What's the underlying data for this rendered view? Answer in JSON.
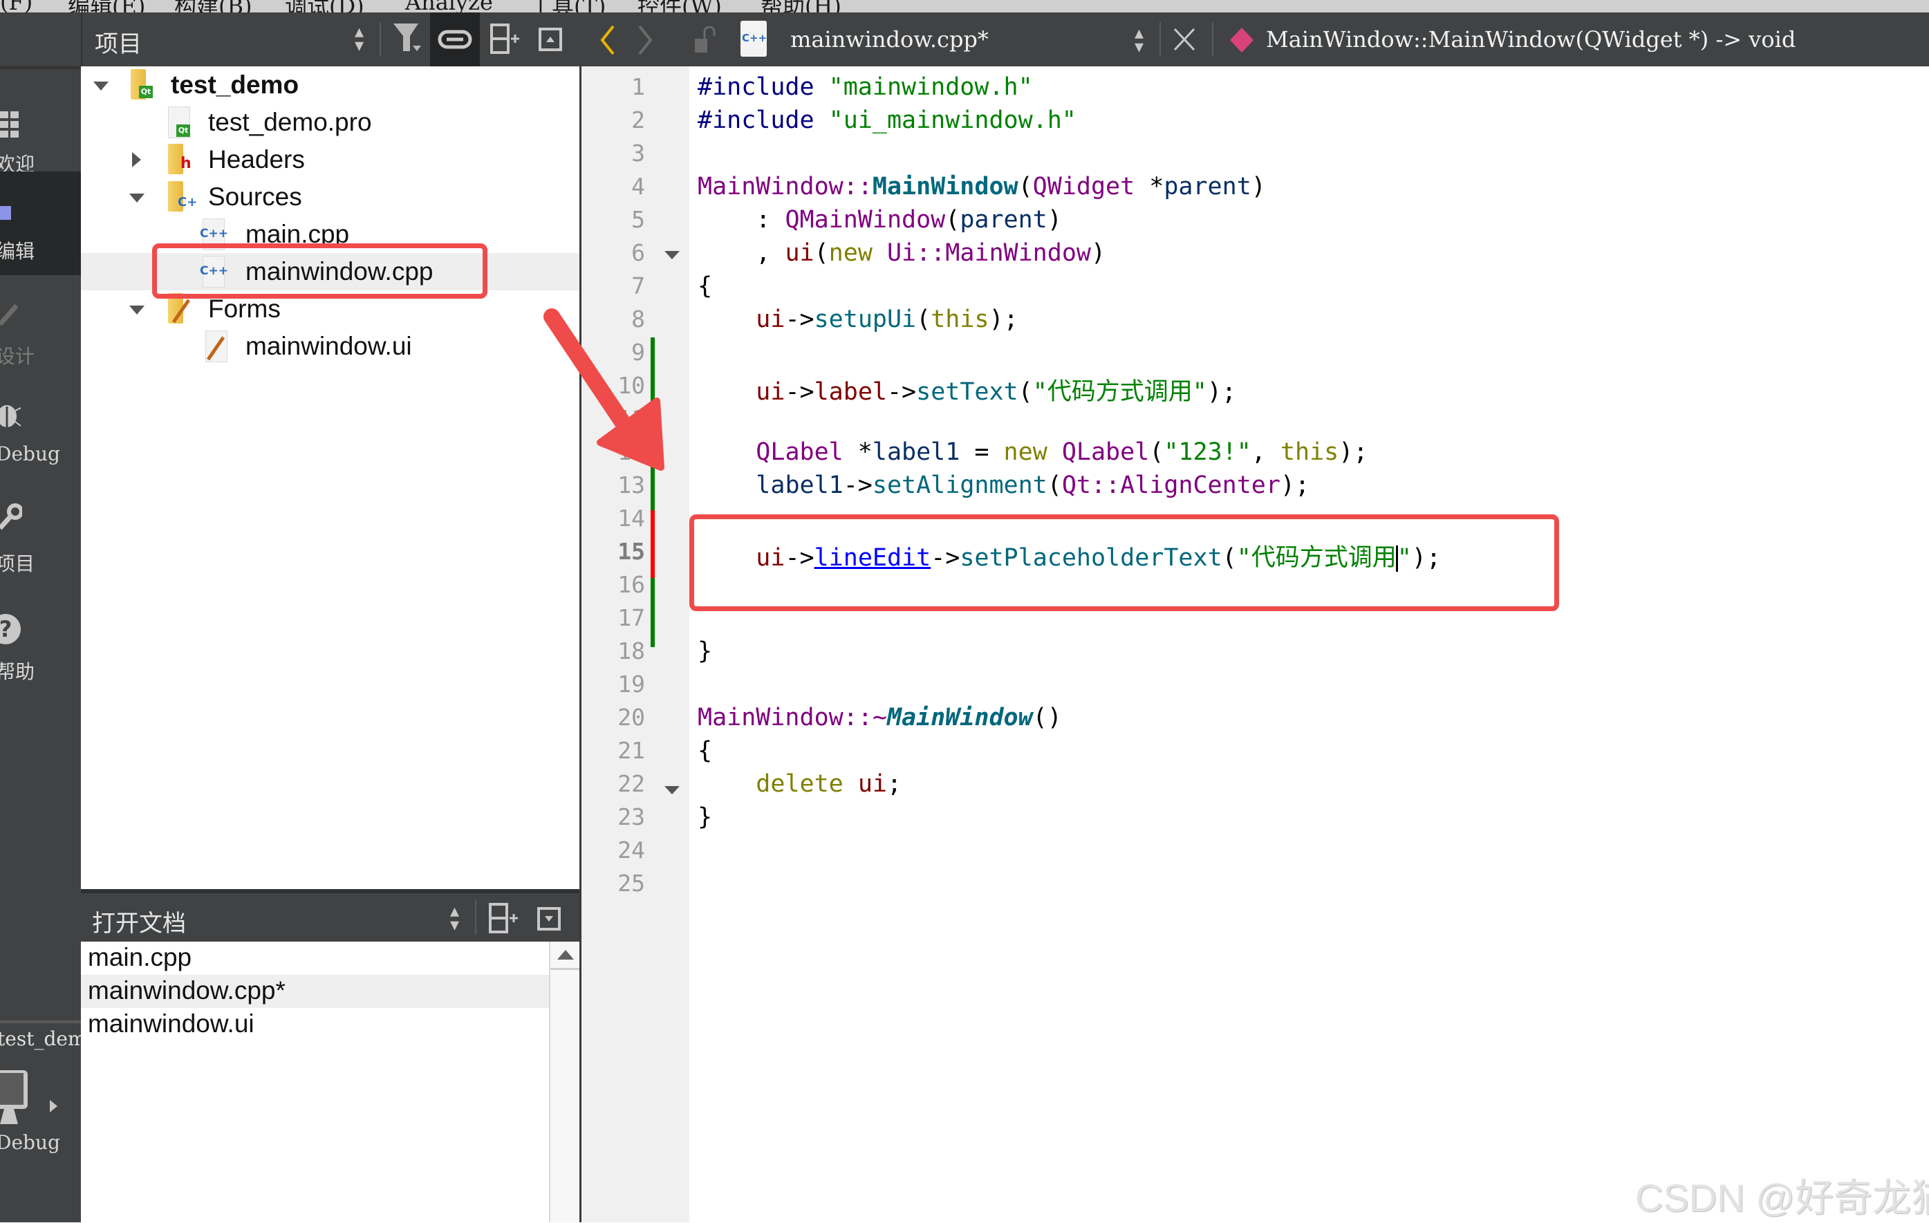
{
  "menu": {
    "items": [
      "(F)",
      "编辑(E)",
      "构建(B)",
      "调试(D)",
      "Analyze",
      "工具(T)",
      "控件(W)",
      "帮助(H)"
    ]
  },
  "modes": [
    {
      "label": "欢迎",
      "icon": "grid-icon",
      "active": false
    },
    {
      "label": "编辑",
      "icon": "edit-doc-icon",
      "active": true
    },
    {
      "label": "设计",
      "icon": "pencil-icon",
      "active": false,
      "disabled": true
    },
    {
      "label": "Debug",
      "icon": "bug-icon",
      "active": false
    },
    {
      "label": "项目",
      "icon": "wrench-icon",
      "active": false
    },
    {
      "label": "帮助",
      "icon": "help-icon",
      "active": false
    }
  ],
  "kit": {
    "project": "test_demo",
    "build": "Debug"
  },
  "project_pane": {
    "title": "项目",
    "tree": [
      {
        "label": "test_demo",
        "level": 0,
        "kind": "project",
        "expanded": true
      },
      {
        "label": "test_demo.pro",
        "level": 1,
        "kind": "pro-file"
      },
      {
        "label": "Headers",
        "level": 1,
        "kind": "folder-h",
        "expanded": false
      },
      {
        "label": "Sources",
        "level": 1,
        "kind": "folder-cpp",
        "expanded": true
      },
      {
        "label": "main.cpp",
        "level": 2,
        "kind": "cpp-file"
      },
      {
        "label": "mainwindow.cpp",
        "level": 2,
        "kind": "cpp-file",
        "selected": true
      },
      {
        "label": "Forms",
        "level": 1,
        "kind": "folder-ui",
        "expanded": true
      },
      {
        "label": "mainwindow.ui",
        "level": 2,
        "kind": "ui-file"
      }
    ]
  },
  "open_docs": {
    "title": "打开文档",
    "items": [
      {
        "label": "main.cpp"
      },
      {
        "label": "mainwindow.cpp*",
        "selected": true
      },
      {
        "label": "mainwindow.ui"
      }
    ]
  },
  "editor": {
    "file_name": "mainwindow.cpp*",
    "symbol": "MainWindow::MainWindow(QWidget *) -> void",
    "current_line": 15,
    "line_numbers": [
      "1",
      "2",
      "3",
      "4",
      "5",
      "6",
      "7",
      "8",
      "9",
      "10",
      "11",
      "12",
      "13",
      "14",
      "15",
      "16",
      "17",
      "18",
      "19",
      "20",
      "21",
      "22",
      "23",
      "24",
      "25"
    ],
    "lines": {
      "l1a": "#include ",
      "l1b": "\"mainwindow.h\"",
      "l2a": "#include ",
      "l2b": "\"ui_mainwindow.h\"",
      "l4a": "MainWindow::",
      "l4b": "MainWindow",
      "l4c": "(",
      "l4d": "QWidget",
      "l4e": " *",
      "l4f": "parent",
      "l4g": ")",
      "l5a": "    : ",
      "l5b": "QMainWindow",
      "l5c": "(",
      "l5d": "parent",
      "l5e": ")",
      "l6a": "    , ",
      "l6b": "ui",
      "l6c": "(",
      "l6d": "new",
      "l6e": " ",
      "l6f": "Ui::MainWindow",
      "l6g": ")",
      "l7a": "{",
      "l8a": "    ",
      "l8b": "ui",
      "l8c": "->",
      "l8d": "setupUi",
      "l8e": "(",
      "l8f": "this",
      "l8g": ");",
      "l10a": "    ",
      "l10b": "ui",
      "l10c": "->",
      "l10d": "label",
      "l10e": "->",
      "l10f": "setText",
      "l10g": "(",
      "l10h": "\"代码方式调用\"",
      "l10i": ");",
      "l12a": "    ",
      "l12b": "QLabel",
      "l12c": " *",
      "l12d": "label1",
      "l12e": " = ",
      "l12f": "new",
      "l12g": " ",
      "l12h": "QLabel",
      "l12i": "(",
      "l12j": "\"123!\"",
      "l12k": ", ",
      "l12l": "this",
      "l12m": ");",
      "l13a": "    ",
      "l13b": "label1",
      "l13c": "->",
      "l13d": "setAlignment",
      "l13e": "(",
      "l13f": "Qt::AlignCenter",
      "l13g": ");",
      "l15a": "    ",
      "l15b": "ui",
      "l15c": "->",
      "l15d": "lineEdit",
      "l15e": "->",
      "l15f": "setPlaceholderText",
      "l15g": "(",
      "l15h": "\"代码方式调用",
      "l15i": "\"",
      "l15j": ");",
      "l18a": "}",
      "l20a": "MainWindow::~",
      "l20b": "MainWindow",
      "l20c": "()",
      "l21a": "{",
      "l22a": "    ",
      "l22b": "delete",
      "l22c": " ",
      "l22d": "ui",
      "l22e": ";",
      "l23a": "}"
    }
  },
  "watermark": "CSDN @好奇龙猫",
  "colors": {
    "annotation_red": "#f04b4b",
    "change_added": "#008000",
    "change_modified": "#ff0000"
  }
}
